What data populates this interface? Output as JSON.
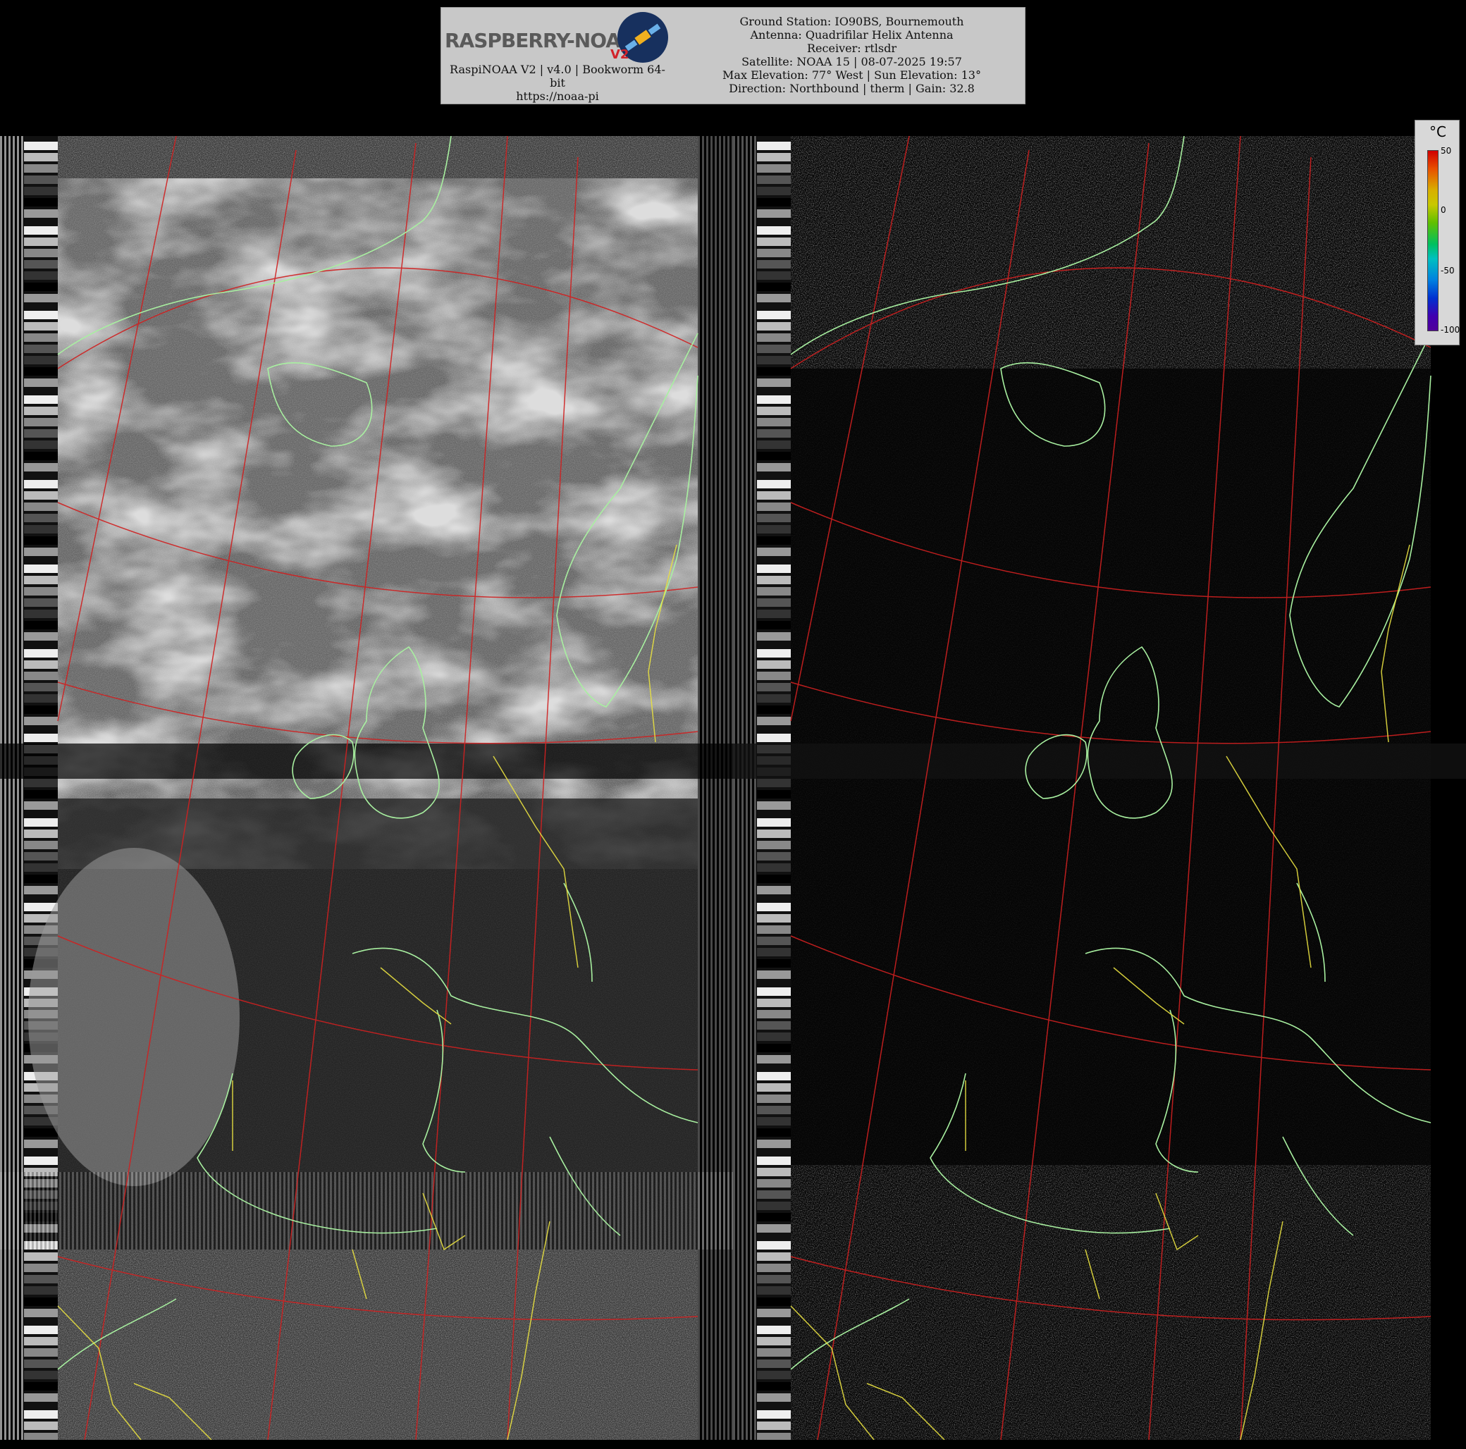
{
  "header": {
    "logo_text": "RASPBERRY-NOAA",
    "logo_version": "V2",
    "left_lines": [
      "RaspiNOAA V2 | v4.0 | Bookworm 64-",
      "bit",
      "https://noaa-pi"
    ],
    "right_lines": [
      "Ground Station: IO90BS, Bournemouth",
      "Antenna: Quadrifilar Helix Antenna",
      "Receiver: rtlsdr",
      "Satellite: NOAA 15 | 08-07-2025 19:57",
      "Max Elevation: 77° West | Sun Elevation: 13°",
      "Direction: Northbound | therm | Gain: 32.8"
    ]
  },
  "panels": [
    {
      "name": "channel-a-visible",
      "tone": "visible"
    },
    {
      "name": "channel-b-thermal",
      "tone": "thermal"
    }
  ],
  "legend": {
    "unit": "°C",
    "ticks": [
      "50",
      "0",
      "-50",
      "-100"
    ]
  },
  "colors": {
    "graticule": "#d02020",
    "coastline": "#a8f0a0",
    "borders": "#e8e040",
    "background": "#000000",
    "banner": "#c8c8c8"
  }
}
